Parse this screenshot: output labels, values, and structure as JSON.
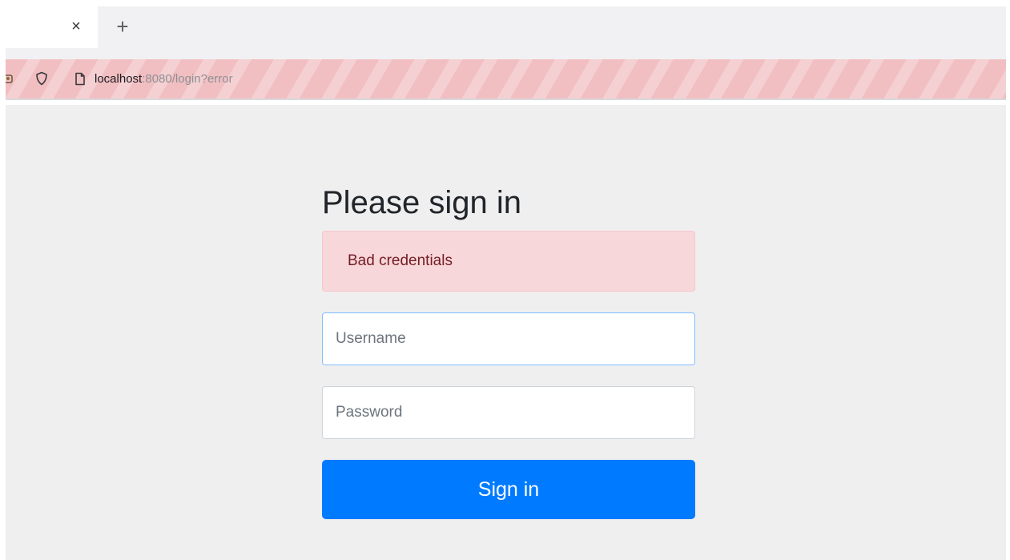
{
  "browser": {
    "tab": {
      "close_glyph": "×"
    },
    "new_tab_glyph": "+",
    "address": {
      "host": "localhost",
      "rest": ":8080/login?error",
      "icons": [
        "tracking-protection-icon",
        "page-info-icon"
      ]
    },
    "urlbar_stripe_color": "#f1bfc2"
  },
  "login": {
    "heading": "Please sign in",
    "error": "Bad credentials",
    "username": {
      "placeholder": "Username",
      "value": ""
    },
    "password": {
      "placeholder": "Password",
      "value": ""
    },
    "submit_label": "Sign in"
  },
  "colors": {
    "page_bg": "#efeff0",
    "alert_bg": "#f8d7da",
    "alert_text": "#721c24",
    "primary": "#007bff"
  }
}
